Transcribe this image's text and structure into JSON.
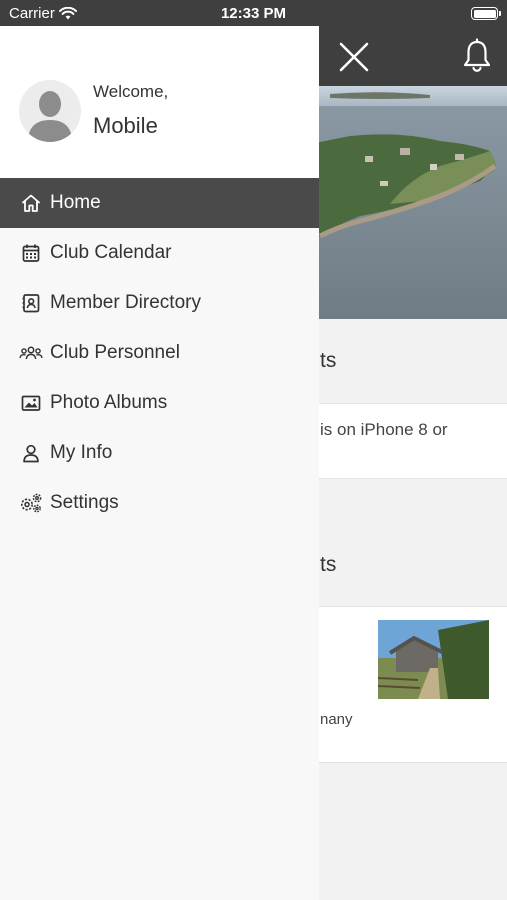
{
  "status_bar": {
    "carrier": "Carrier",
    "time": "12:33 PM"
  },
  "header": {
    "close_icon": "close-icon",
    "bell_icon": "bell-icon",
    "color": "#3f3f3f"
  },
  "background": {
    "section1_title": "ts",
    "section1_text": "is on iPhone 8 or",
    "section2_title": "ts",
    "section2_text": "nany"
  },
  "drawer": {
    "welcome": "Welcome,",
    "username": "Mobile",
    "items": [
      {
        "label": "Home",
        "icon": "home-icon",
        "active": true
      },
      {
        "label": "Club Calendar",
        "icon": "calendar-icon",
        "active": false
      },
      {
        "label": "Member Directory",
        "icon": "contacts-icon",
        "active": false
      },
      {
        "label": "Club Personnel",
        "icon": "group-icon",
        "active": false
      },
      {
        "label": "Photo Albums",
        "icon": "image-icon",
        "active": false
      },
      {
        "label": "My Info",
        "icon": "person-icon",
        "active": false
      },
      {
        "label": "Settings",
        "icon": "gears-icon",
        "active": false
      }
    ]
  },
  "colors": {
    "active_item": "#4a4a4a",
    "drawer_bg": "#f8f8f8"
  }
}
